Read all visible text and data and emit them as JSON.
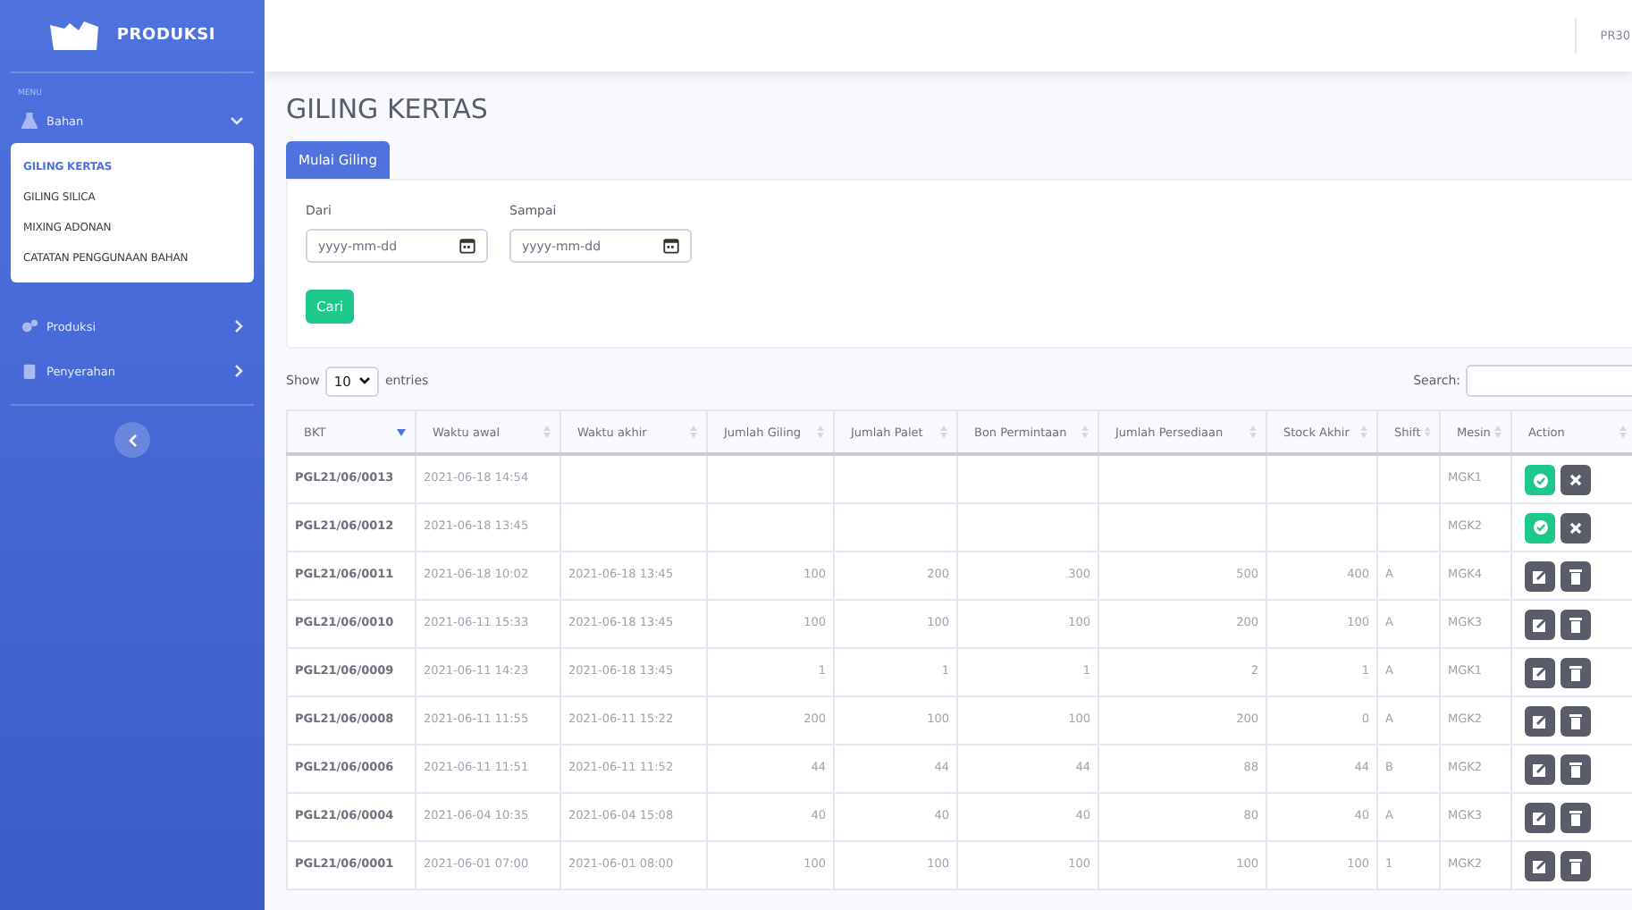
{
  "sidebar": {
    "brand": "PRODUKSI",
    "menu_label": "MENU",
    "items": [
      {
        "label": "Bahan",
        "expanded": true,
        "children": [
          {
            "label": "GILING KERTAS",
            "selected": true
          },
          {
            "label": "GILING SILICA",
            "selected": false
          },
          {
            "label": "MIXING ADONAN",
            "selected": false
          },
          {
            "label": "CATATAN PENGGUNAAN BAHAN",
            "selected": false
          }
        ]
      },
      {
        "label": "Produksi",
        "expanded": false
      },
      {
        "label": "Penyerahan",
        "expanded": false
      }
    ]
  },
  "topbar": {
    "user": "PR30"
  },
  "page_title": "GILING KERTAS",
  "tab": "Mulai Giling",
  "filter": {
    "from_label": "Dari",
    "from_placeholder": "yyyy-mm-dd",
    "to_label": "Sampai",
    "to_placeholder": "yyyy-mm-dd",
    "button": "Cari"
  },
  "table": {
    "show_label": "Show",
    "page_size": "10",
    "entries_label": "entries",
    "search_label": "Search:",
    "columns": [
      {
        "label": "BKT",
        "sorted": true
      },
      {
        "label": "Waktu awal",
        "sorted": false
      },
      {
        "label": "Waktu akhir",
        "sorted": false
      },
      {
        "label": "Jumlah Giling",
        "sorted": false
      },
      {
        "label": "Jumlah Palet",
        "sorted": false
      },
      {
        "label": "Bon Permintaan",
        "sorted": false
      },
      {
        "label": "Jumlah Persediaan",
        "sorted": false
      },
      {
        "label": "Stock Akhir",
        "sorted": false
      },
      {
        "label": "Shift",
        "sorted": false
      },
      {
        "label": "Mesin",
        "sorted": false
      },
      {
        "label": "Action",
        "sorted": false
      }
    ],
    "rows": [
      {
        "kind": "pending",
        "cells": [
          "PGL21/06/0013",
          "2021-06-18 14:54",
          "",
          "",
          "",
          "",
          "",
          "",
          "",
          "MGK1"
        ]
      },
      {
        "kind": "pending",
        "cells": [
          "PGL21/06/0012",
          "2021-06-18 13:45",
          "",
          "",
          "",
          "",
          "",
          "",
          "",
          "MGK2"
        ]
      },
      {
        "kind": "done",
        "cells": [
          "PGL21/06/0011",
          "2021-06-18 10:02",
          "2021-06-18 13:45",
          "100",
          "200",
          "300",
          "500",
          "400",
          "A",
          "MGK4"
        ]
      },
      {
        "kind": "done",
        "cells": [
          "PGL21/06/0010",
          "2021-06-11 15:33",
          "2021-06-18 13:45",
          "100",
          "100",
          "100",
          "200",
          "100",
          "A",
          "MGK3"
        ]
      },
      {
        "kind": "done",
        "cells": [
          "PGL21/06/0009",
          "2021-06-11 14:23",
          "2021-06-18 13:45",
          "1",
          "1",
          "1",
          "2",
          "1",
          "A",
          "MGK1"
        ]
      },
      {
        "kind": "done",
        "cells": [
          "PGL21/06/0008",
          "2021-06-11 11:55",
          "2021-06-11 15:22",
          "200",
          "100",
          "100",
          "200",
          "0",
          "A",
          "MGK2"
        ]
      },
      {
        "kind": "done",
        "cells": [
          "PGL21/06/0006",
          "2021-06-11 11:51",
          "2021-06-11 11:52",
          "44",
          "44",
          "44",
          "88",
          "44",
          "B",
          "MGK2"
        ]
      },
      {
        "kind": "done",
        "cells": [
          "PGL21/06/0004",
          "2021-06-04 10:35",
          "2021-06-04 15:08",
          "40",
          "40",
          "40",
          "80",
          "40",
          "A",
          "MGK3"
        ]
      },
      {
        "kind": "done",
        "cells": [
          "PGL21/06/0001",
          "2021-06-01 07:00",
          "2021-06-01 08:00",
          "100",
          "100",
          "100",
          "100",
          "100",
          "1",
          "MGK2"
        ]
      }
    ]
  }
}
